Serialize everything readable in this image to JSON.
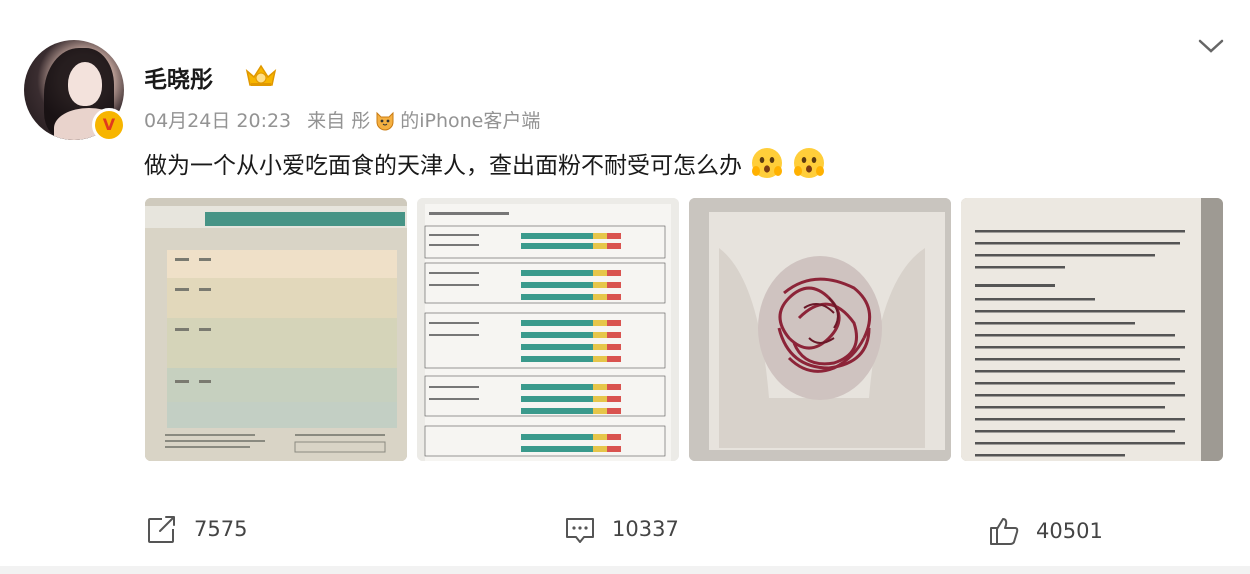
{
  "post": {
    "author_name": "毛晓彤",
    "time": "04月24日 20:23",
    "source_prefix": "来自 彤",
    "source_suffix": "的iPhone客户端",
    "text": "做为一个从小爱吃面食的天津人，查出面粉不耐受可怎么办",
    "photos": [
      {
        "name": "report-cover-photo"
      },
      {
        "name": "report-chart-photo"
      },
      {
        "name": "intestine-photo"
      },
      {
        "name": "report-text-photo"
      }
    ]
  },
  "actions": {
    "repost_count": "7575",
    "comment_count": "10337",
    "like_count": "40501"
  },
  "colors": {
    "meta_gray": "#939393",
    "vip_gold": "#f7b500",
    "verified_red": "#e03a1e"
  },
  "icons": [
    "chevron-down-icon",
    "crown-badge-icon",
    "cat-emoji-icon",
    "shocked-emoji-icon",
    "repost-icon",
    "comment-icon",
    "like-icon"
  ]
}
